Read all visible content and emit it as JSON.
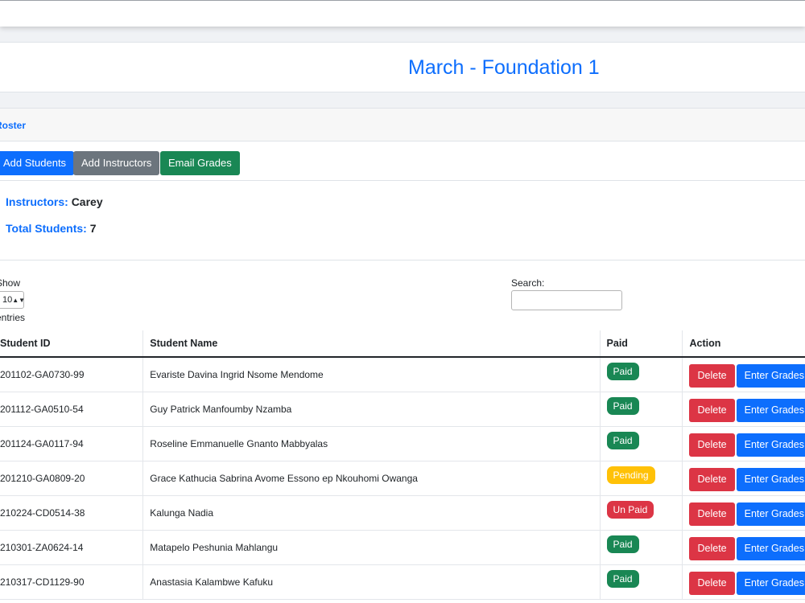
{
  "page": {
    "title": "March - Foundation 1"
  },
  "card_header": {
    "tab_label": "Roster"
  },
  "toolbar": {
    "add_students": "Add Students",
    "add_instructors": "Add Instructors",
    "email_grades": "Email Grades"
  },
  "info": {
    "instructors_label": "Instructors:",
    "instructors_value": "Carey",
    "total_label": "Total Students:",
    "total_value": "7"
  },
  "datatable": {
    "show_label": "Show",
    "entries_value": "10",
    "entries_label": "entries",
    "search_label": "Search:",
    "search_value": ""
  },
  "table": {
    "headers": {
      "id": "Student ID",
      "name": "Student Name",
      "paid": "Paid",
      "action": "Action"
    },
    "delete_label": "Delete",
    "grades_label": "Enter Grades",
    "rows": [
      {
        "id": "201102-GA0730-99",
        "name": "Evariste Davina Ingrid Nsome Mendome",
        "status": "Paid"
      },
      {
        "id": "201112-GA0510-54",
        "name": "Guy Patrick Manfoumby Nzamba",
        "status": "Paid"
      },
      {
        "id": "201124-GA0117-94",
        "name": "Roseline Emmanuelle Gnanto Mabbyalas",
        "status": "Paid"
      },
      {
        "id": "201210-GA0809-20",
        "name": "Grace Kathucia Sabrina Avome Essono ep Nkouhomi Owanga",
        "status": "Pending"
      },
      {
        "id": "210224-CD0514-38",
        "name": "Kalunga Nadia",
        "status": "Un Paid"
      },
      {
        "id": "210301-ZA0624-14",
        "name": "Matapelo Peshunia Mahlangu",
        "status": "Paid"
      },
      {
        "id": "210317-CD1129-90",
        "name": "Anastasia Kalambwe Kafuku",
        "status": "Paid"
      }
    ]
  },
  "colors": {
    "primary": "#0d6efd",
    "secondary": "#6c757d",
    "success": "#198754",
    "warning": "#ffc107",
    "danger": "#dc3545"
  }
}
